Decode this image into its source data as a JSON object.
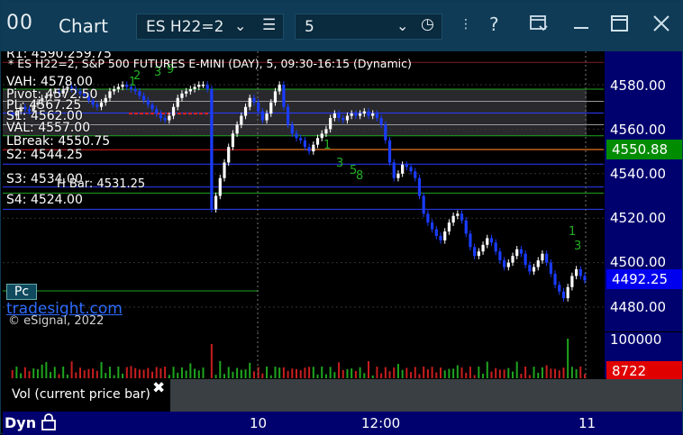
{
  "titlebar": {
    "logo": "00",
    "title": "Chart",
    "symbol": "ES H22=2",
    "interval": "5",
    "icons": [
      "list-icon",
      "clock-icon",
      "pin-icon",
      "help-icon",
      "layout-icon",
      "minimize-icon",
      "maximize-icon",
      "close-icon"
    ]
  },
  "chart": {
    "header": "* ES H22=2, S&P 500 FUTURES E-MINI (DAY), 5, 09:30-16:15 (Dynamic)",
    "r1": "R1: 4590.259.75",
    "levels": {
      "vah": "VAH: 4578.00",
      "pivot": "Pivot: 4572.50",
      "pl1": "PL: 4567.25",
      "s1": "S1: 4562.00",
      "val": "VAL: 4557.00",
      "lbreak": "LBreak: 4550.75",
      "s2": "S2: 4544.25",
      "s3": "S3: 4534.00",
      "hibar": "H Bar: 4531.25",
      "s4": "S4: 4524.00"
    },
    "axis_labels": [
      "4580.00",
      "4560.00",
      "4540.00",
      "4520.00",
      "4500.00",
      "4480.00"
    ],
    "badge_green": "4550.88",
    "badge_blue": "4492.25",
    "tradesight": "tradesight.com",
    "esignal": "© eSignal, 2022",
    "pc_button": "Pc",
    "seq_labels": [
      "1",
      "2",
      "3",
      "9",
      "1",
      "3"
    ],
    "colors": {
      "up": "#ffffff",
      "down": "#1a3cff",
      "green_line": "#1fa51f",
      "red_line": "#e02020",
      "blue_line": "#2a3cff",
      "axis_bg": "#00006e",
      "titlebar": "#0f3b56"
    }
  },
  "volume": {
    "axis_top": "100000",
    "badge_red": "8722",
    "tooltip": "Vol (current price bar)"
  },
  "timeaxis": {
    "dyn": "Dyn",
    "labels": [
      "10",
      "12:00",
      "11"
    ]
  }
}
